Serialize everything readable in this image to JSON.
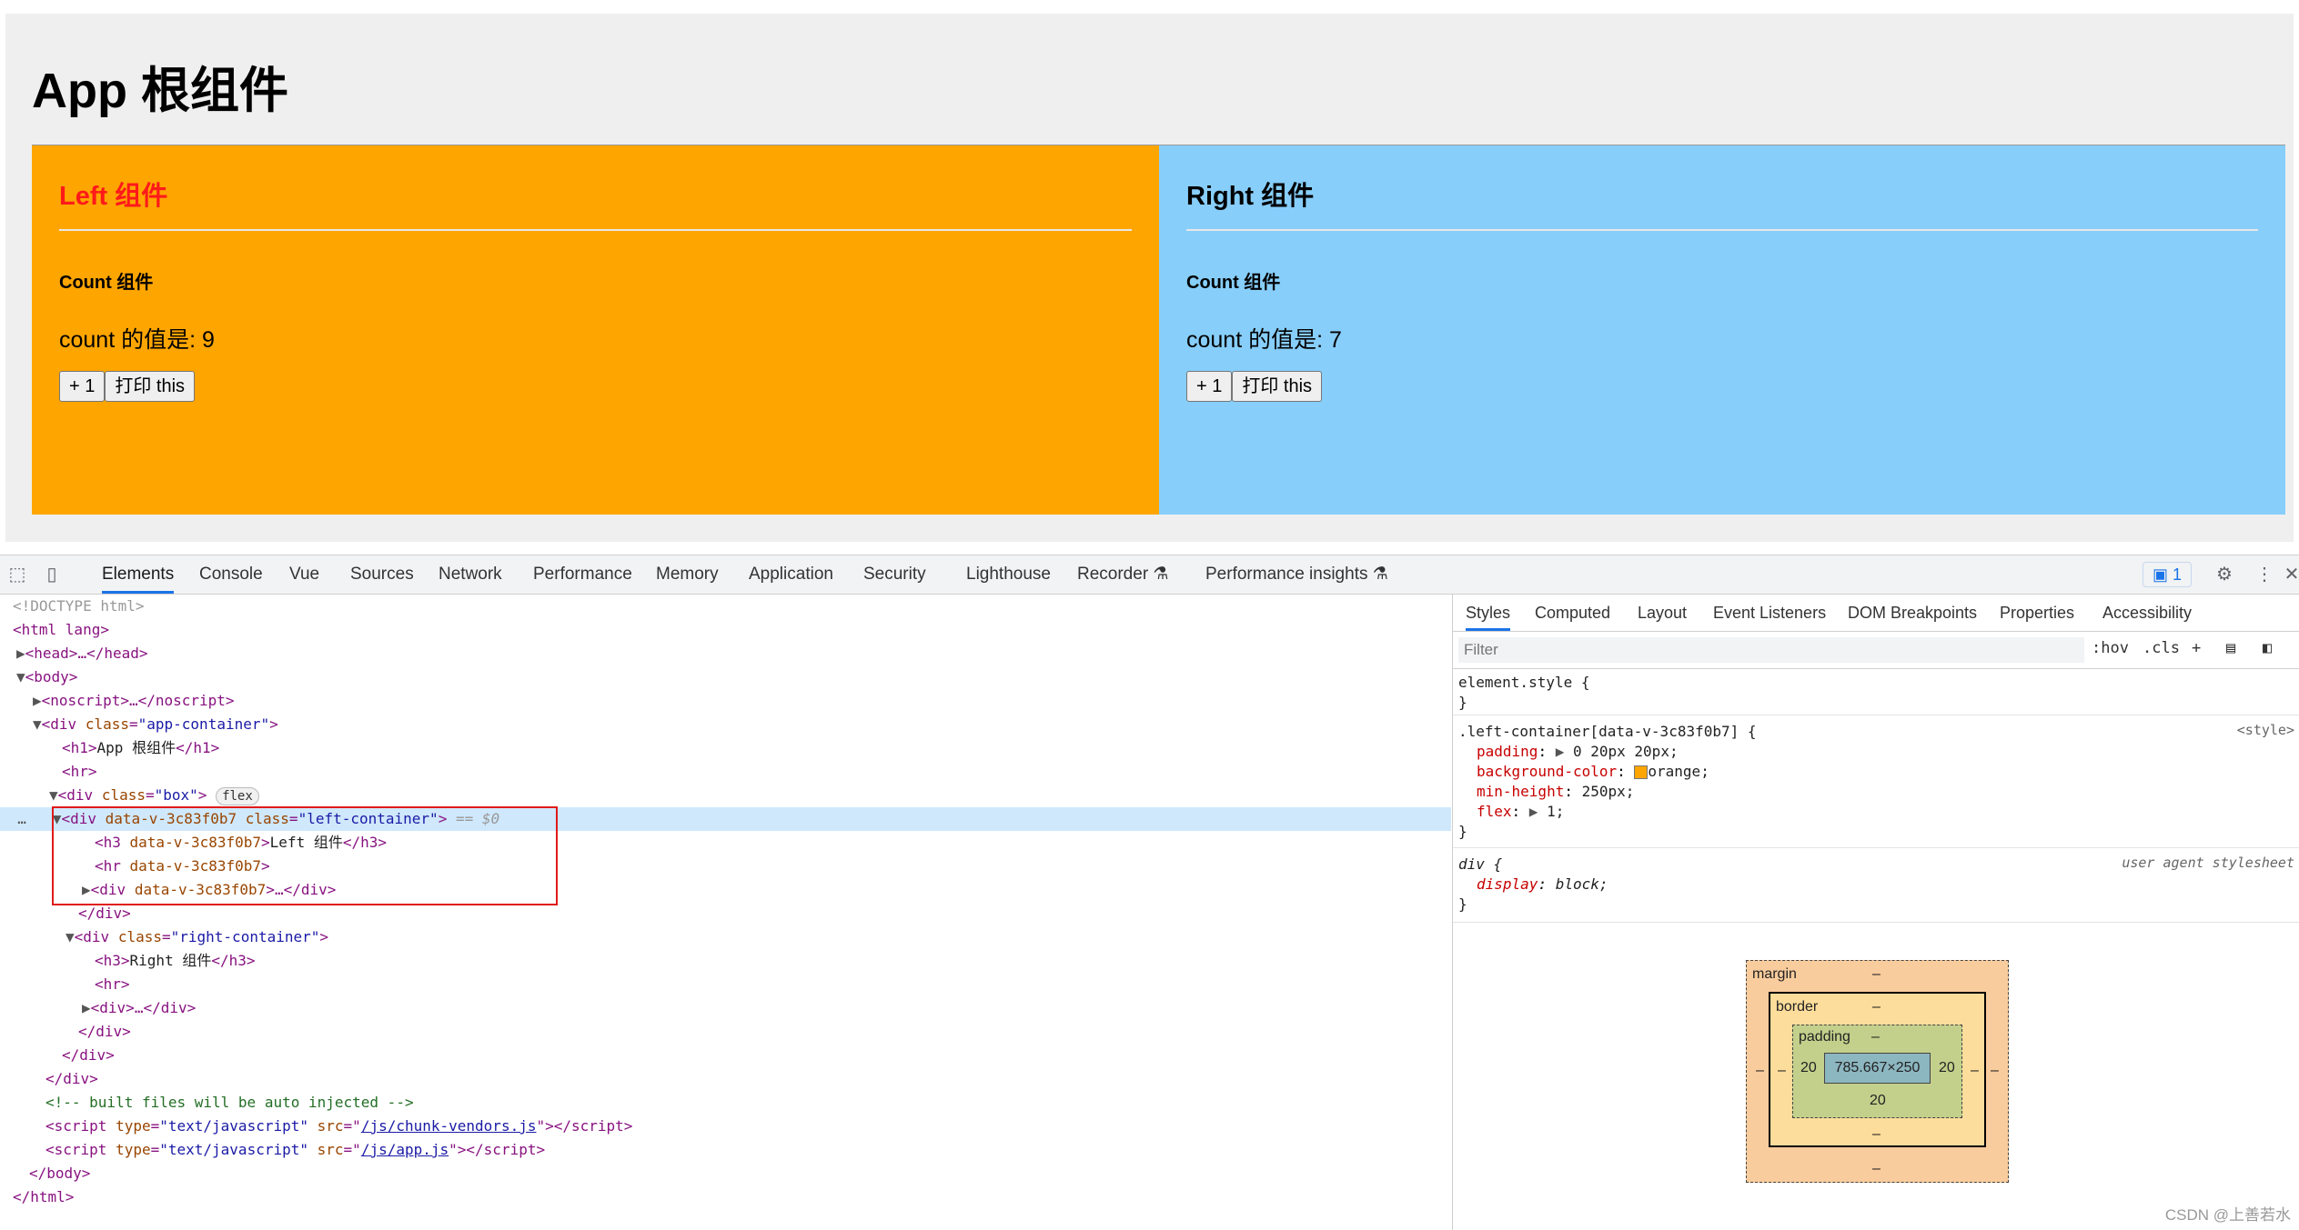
{
  "app": {
    "title": "App 根组件",
    "left": {
      "title": "Left 组件",
      "count_title": "Count 组件",
      "count_text": "count 的值是: 9",
      "plus_button": "+ 1",
      "print_button": "打印 this",
      "color": "#ffa500"
    },
    "right": {
      "title": "Right 组件",
      "count_title": "Count 组件",
      "count_text": "count 的值是: 7",
      "plus_button": "+ 1",
      "print_button": "打印 this",
      "color": "#87cefa"
    }
  },
  "devtools": {
    "tabs": [
      "Elements",
      "Console",
      "Vue",
      "Sources",
      "Network",
      "Performance",
      "Memory",
      "Application",
      "Security",
      "Lighthouse",
      "Recorder ⚗",
      "Performance insights ⚗"
    ],
    "issues_count": "1",
    "dom": {
      "l1": "<!DOCTYPE html>",
      "l2": "<html lang>",
      "l3_tag": "<head>",
      "l3_end": "…</head>",
      "l4": "<body>",
      "l5_tag": "<noscript>",
      "l5_end": "…</noscript>",
      "l6_open": "<div ",
      "l6_attr": "class",
      "l6_val": "\"app-container\"",
      "l7_tag": "<h1>",
      "l7_txt": "App 根组件",
      "l7_end": "</h1>",
      "l8": "<hr>",
      "l9_open": "<div ",
      "l9_attr": "class",
      "l9_val": "\"box\"",
      "l9_badge": "flex",
      "l10_open": "<div ",
      "l10_attr1": "data-v-3c83f0b7",
      "l10_attr2": "class",
      "l10_val": "\"left-container\"",
      "l10_eq": "== $0",
      "l11_open": "<h3 ",
      "l11_attr": "data-v-3c83f0b7",
      "l11_txt": "Left 组件",
      "l11_end": "</h3>",
      "l12_open": "<hr ",
      "l12_attr": "data-v-3c83f0b7",
      "l13_open": "<div ",
      "l13_attr": "data-v-3c83f0b7",
      "l13_end": "…</div>",
      "l14": "</div>",
      "l15_open": "<div ",
      "l15_attr": "class",
      "l15_val": "\"right-container\"",
      "l16_tag": "<h3>",
      "l16_txt": "Right 组件",
      "l16_end": "</h3>",
      "l17": "<hr>",
      "l18_tag": "<div>",
      "l18_end": "…</div>",
      "l19": "</div>",
      "l20": "</div>",
      "l21": "</div>",
      "l22": "<!-- built files will be auto injected -->",
      "l23_open": "<script ",
      "l23_attr1": "type",
      "l23_val1": "\"text/javascript\"",
      "l23_attr2": "src",
      "l23_link": "/js/chunk-vendors.js",
      "l24_link": "/js/app.js",
      "l25": "</body>",
      "l26": "</html>"
    },
    "styles": {
      "tabs": [
        "Styles",
        "Computed",
        "Layout",
        "Event Listeners",
        "DOM Breakpoints",
        "Properties",
        "Accessibility"
      ],
      "filter_placeholder": "Filter",
      "hov": ":hov",
      "cls": ".cls",
      "element_style": "element.style {",
      "close_brace": "}",
      "rule_selector": ".left-container[data-v-3c83f0b7] {",
      "rule_source": "<style>",
      "padding_prop": "padding",
      "padding_val": "0 20px 20px;",
      "bg_prop": "background-color",
      "bg_val": "orange;",
      "minh_prop": "min-height",
      "minh_val": "250px;",
      "flex_prop": "flex",
      "flex_val": "1;",
      "div_selector": "div {",
      "div_source": "user agent stylesheet",
      "display_prop": "display",
      "display_val": "block;"
    },
    "box_model": {
      "margin_label": "margin",
      "border_label": "border",
      "padding_label": "padding",
      "dash": "–",
      "content": "785.667×250",
      "padding_left": "20",
      "padding_right": "20",
      "padding_bottom": "20"
    }
  },
  "watermark": "CSDN @上善若水"
}
